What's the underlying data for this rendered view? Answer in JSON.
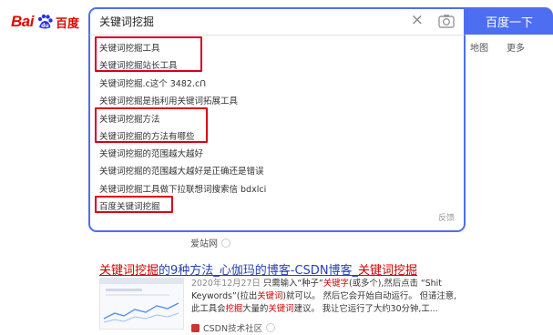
{
  "logo": {
    "bai": "Bai",
    "du": "du",
    "cn": "百度"
  },
  "search": {
    "query": "关键词挖掘",
    "clear_glyph": "×",
    "button_label": "百度一下"
  },
  "nav": {
    "map": "地图",
    "more": "更多"
  },
  "suggestions": {
    "items": [
      "关键词挖掘工具",
      "关键词挖掘站长工具",
      "关键词挖掘.c这个 3482.cՈ",
      "关键词挖掘是指利用关键词拓展工具",
      "关键词挖掘方法",
      "关键词挖掘的方法有哪些",
      "关键词挖掘的范围越大越好",
      "关键词挖掘的范围越大越好是正确还是错误",
      "关键词挖掘工具做下拉联想词搜索信 bdxlci",
      "百度关键词挖掘"
    ],
    "feedback": "反馈",
    "highlight_color": "#d8001a"
  },
  "prev_result": {
    "source": "爱站网"
  },
  "result": {
    "title_kw": "关键词挖掘",
    "title_rest": "的9种方法_心伽玛的博客-CSDN博客_",
    "title_kw2": "关键词挖掘",
    "date": "2020年12月27日",
    "snippet_1": "只需输入“种子”",
    "snippet_kw1": "关键字",
    "snippet_2": "(或多个),然后点击 “Shit Keywords”(拉出",
    "snippet_kw2": "关键词",
    "snippet_3": ")就可以。 然后它会开始自动运行。 但请注意,此工具会",
    "snippet_kw3": "挖掘",
    "snippet_4": "大量的",
    "snippet_kw4": "关键词",
    "snippet_5": "建议。 我让它运行了大约30分钟,工...",
    "source": "CSDN技术社区"
  },
  "colors": {
    "brand_blue": "#4e6ef2",
    "link_blue": "#2440b3",
    "keyword_red": "#c00"
  }
}
